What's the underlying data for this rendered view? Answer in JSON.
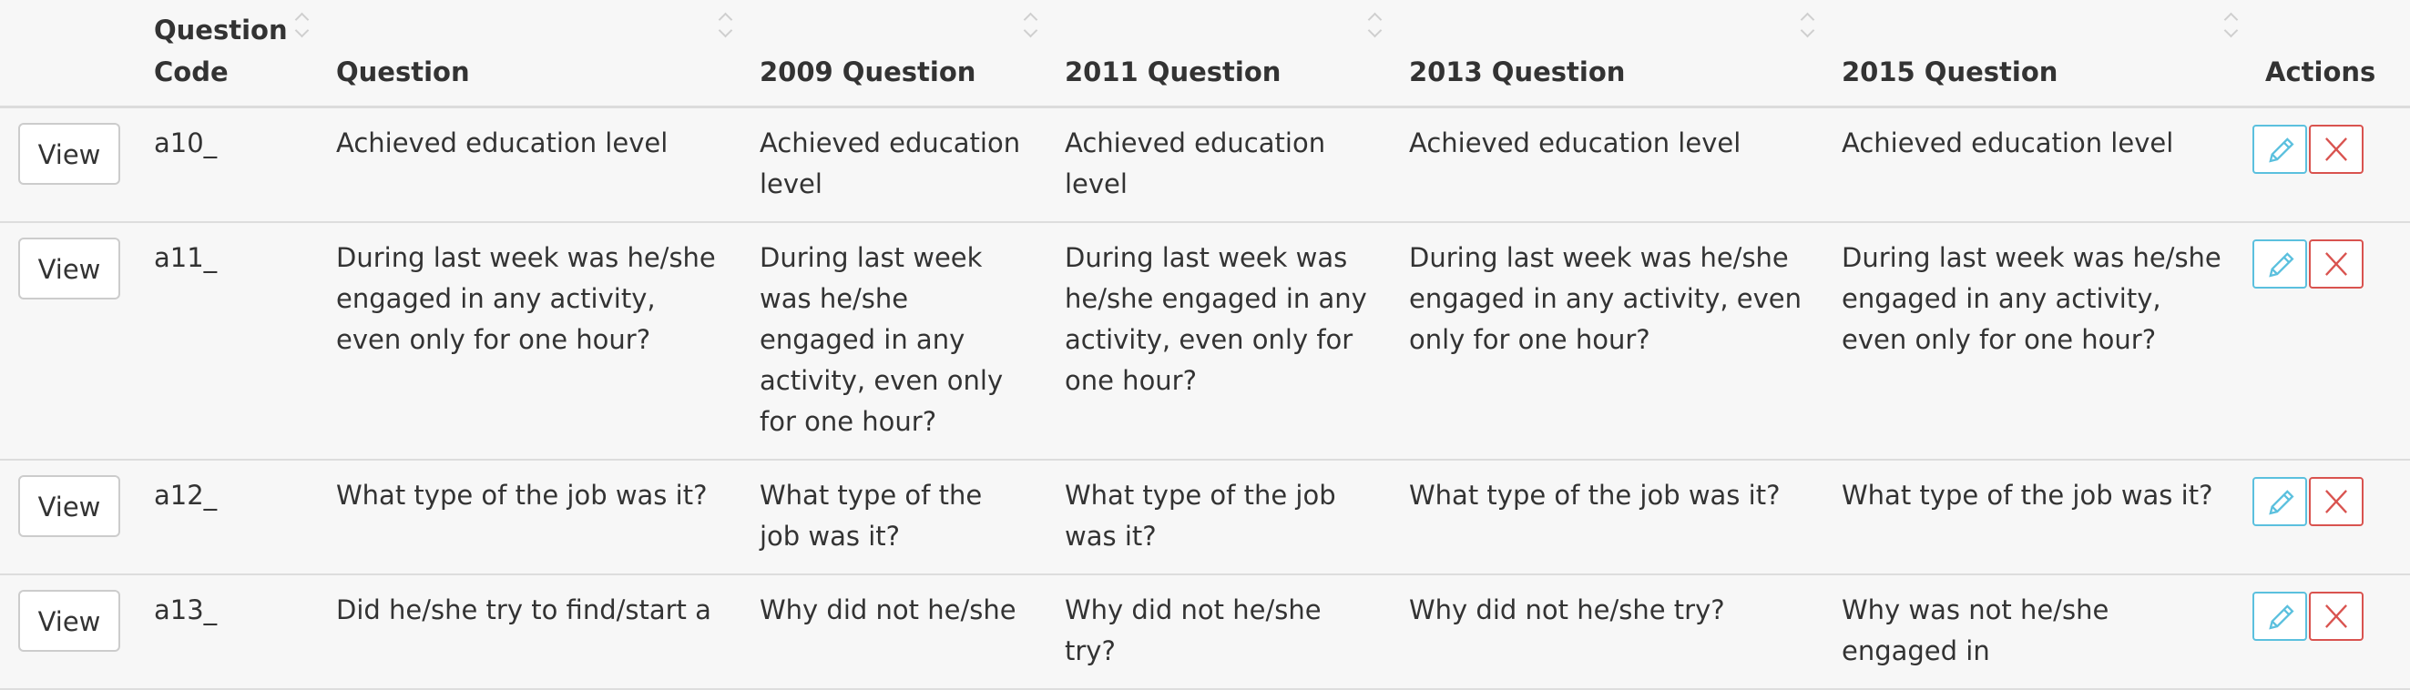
{
  "table": {
    "columns": [
      {
        "label": "Question\nCode",
        "sortable": true
      },
      {
        "label": "Question",
        "sortable": true
      },
      {
        "label": "2009 Question",
        "sortable": true
      },
      {
        "label": "2011 Question",
        "sortable": true
      },
      {
        "label": "2013 Question",
        "sortable": true
      },
      {
        "label": "2015 Question",
        "sortable": true
      },
      {
        "label": "Actions",
        "sortable": false
      }
    ],
    "rows": [
      {
        "view_label": "View",
        "code": "a10_",
        "question": "Achieved education level",
        "q2009": "Achieved education level",
        "q2011": "Achieved education level",
        "q2013": "Achieved education level",
        "q2015": "Achieved education level"
      },
      {
        "view_label": "View",
        "code": "a11_",
        "question": "During last week was he/she engaged in any activity, even only for one hour?",
        "q2009": "During last week was he/she engaged in any activity, even only for one hour?",
        "q2011": "During last week was he/she engaged in any activity, even only for one hour?",
        "q2013": "During last week was he/she engaged in any activity, even only for one hour?",
        "q2015": "During last week was he/she engaged in any activity, even only for one hour?"
      },
      {
        "view_label": "View",
        "code": "a12_",
        "question": "What type of the job was it?",
        "q2009": "What type of the job was it?",
        "q2011": "What type of the job was it?",
        "q2013": "What type of the job was it?",
        "q2015": "What type of the job was it?"
      },
      {
        "view_label": "View",
        "code": "a13_",
        "question": "Did he/she try to find/start a",
        "q2009": "Why did not he/she",
        "q2011": "Why did not he/she try?",
        "q2013": "Why did not he/she try?",
        "q2015": "Why was not he/she engaged in"
      }
    ]
  },
  "icons": {
    "edit": "pencil-icon",
    "delete": "close-icon",
    "sort": "sort-icon"
  },
  "colors": {
    "background": "#f7f7f7",
    "edit_border": "#5bc0de",
    "delete_border": "#d9534f",
    "sort_arrow": "#cfcfcf"
  }
}
